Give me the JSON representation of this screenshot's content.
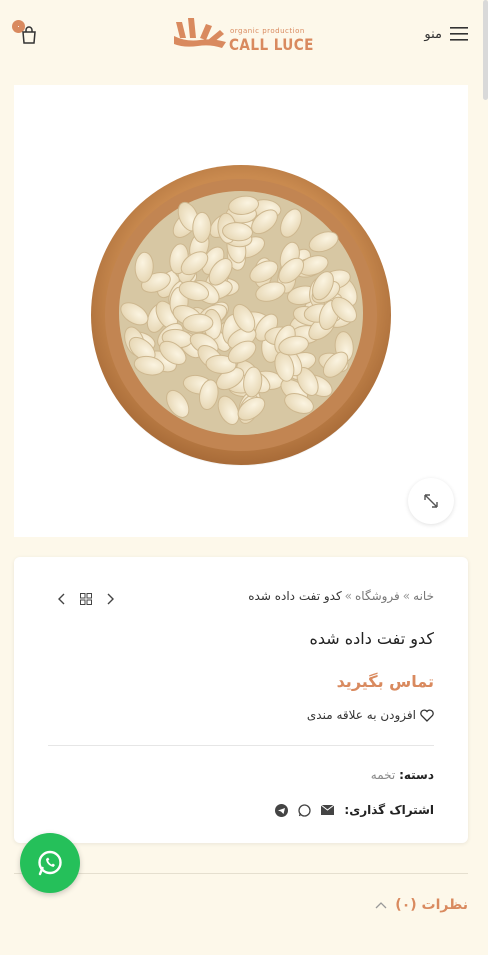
{
  "header": {
    "cart_count": "۰",
    "logo_tagline": "organic production",
    "logo_name": "CALL LUCE",
    "menu_label": "منو"
  },
  "product": {
    "breadcrumb": {
      "home": "خانه",
      "separator": "»",
      "shop": "فروشگاه",
      "current": "کدو تفت داده شده"
    },
    "title": "کدو تفت داده شده",
    "price_label": "تماس بگیرید",
    "wishlist_label": "افزودن به علاقه مندی",
    "category_label": "دسته:",
    "category_value": "تخمه",
    "share_label": "اشتراک گذاری:"
  },
  "reviews": {
    "label": "نظرات (۰)"
  },
  "colors": {
    "accent": "#d98a5f",
    "background": "#fdf8ea",
    "whatsapp": "#25c05a"
  },
  "icons": {
    "cart": "shopping-bag-icon",
    "menu": "hamburger-icon",
    "zoom": "expand-icon",
    "whatsapp": "whatsapp-icon"
  }
}
